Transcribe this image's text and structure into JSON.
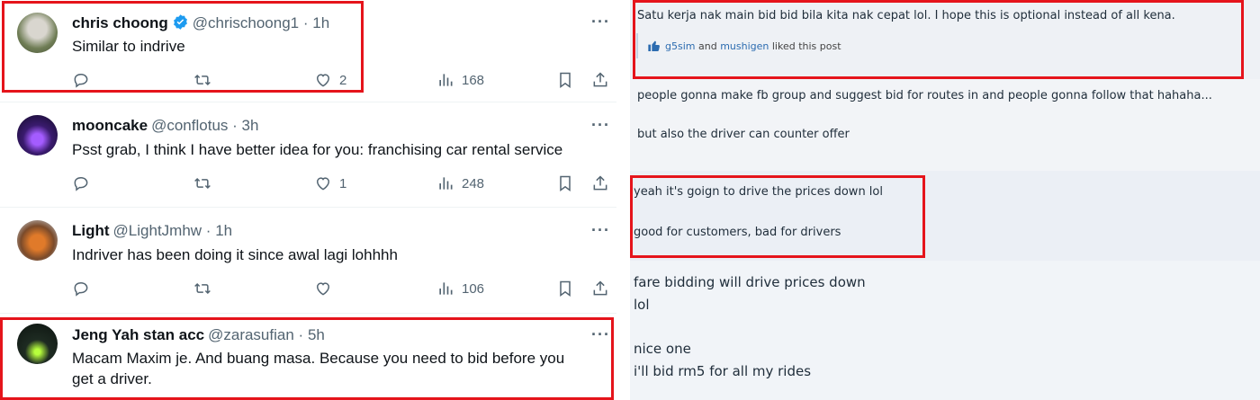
{
  "tweets": [
    {
      "name": "chris choong",
      "verified": true,
      "handle": "@chrischoong1",
      "dot": "·",
      "time": "1h",
      "body": "Similar to indrive",
      "replies": "",
      "retweets": "",
      "likes": "2",
      "views": "168"
    },
    {
      "name": "mooncake",
      "verified": false,
      "handle": "@conflotus",
      "dot": "·",
      "time": "3h",
      "body": "Psst grab, I think I have better idea for you: franchising car rental service",
      "replies": "",
      "retweets": "",
      "likes": "1",
      "views": "248"
    },
    {
      "name": "Light",
      "verified": false,
      "handle": "@LightJmhw",
      "dot": "·",
      "time": "1h",
      "body": "Indriver has been doing it since awal lagi lohhhh",
      "replies": "",
      "retweets": "",
      "likes": "",
      "views": "106"
    },
    {
      "name": "Jeng Yah stan acc",
      "verified": false,
      "handle": "@zarasufian",
      "dot": "·",
      "time": "5h",
      "body_line1": "Macam Maxim je. And buang masa. Because you need to bid before you",
      "body_line2": "get a driver."
    }
  ],
  "more_glyph": "···",
  "forum": {
    "post1": {
      "text": "Satu kerja nak main bid bid bila kita nak cepat lol. I hope this is optional instead of all kena.",
      "liker1": "g5sim",
      "and": "and",
      "liker2": "mushigen",
      "liked_suffix": "liked this post"
    },
    "post2": {
      "line1": "people gonna make fb group and suggest bid for routes in and people gonna follow that hahaha...",
      "line2": "but also the driver can counter offer"
    },
    "post3": {
      "line1": "yeah it's goign to drive the prices down lol",
      "line2": "good for customers, bad for drivers"
    },
    "post4": {
      "line1": "fare bidding will drive prices down",
      "line2": "lol",
      "line3": "nice one",
      "line4": "i'll bid rm5 for all my rides"
    }
  },
  "colors": {
    "highlight_box": "#e5141b",
    "verified": "#1d9bf0",
    "muted": "#536471"
  }
}
